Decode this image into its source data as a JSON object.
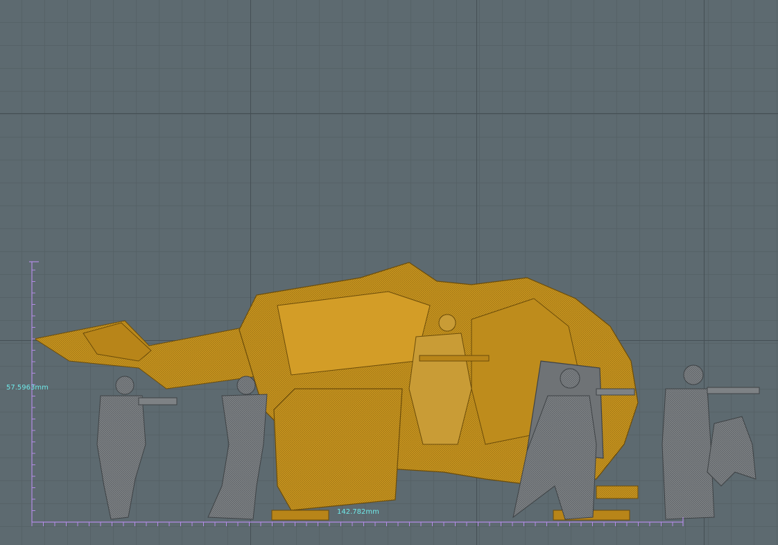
{
  "viewport": {
    "background_color": "#5d6a70",
    "grid_color": "#556065",
    "major_grid_color": "#454f54"
  },
  "measurements": {
    "height_label": "57.5963mm",
    "width_label": "142.782mm",
    "label_color": "#6fe8e8",
    "ruler_color": "#b38be6"
  },
  "models": {
    "vehicle_color": "#c9951f",
    "figure_color": "#7e8285"
  }
}
